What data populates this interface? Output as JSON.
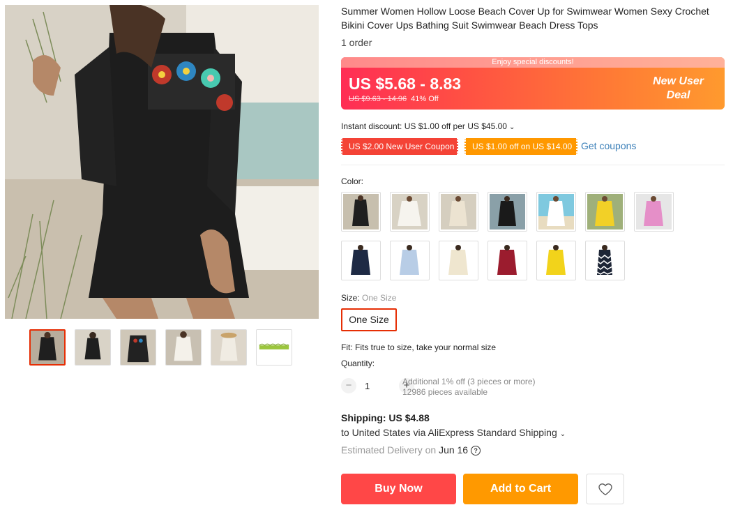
{
  "gallery": {
    "thumbnails": [
      {
        "alt": "black dress front",
        "active": true
      },
      {
        "alt": "black dress model outdoors",
        "active": false
      },
      {
        "alt": "black dress crochet detail",
        "active": false
      },
      {
        "alt": "white dress model",
        "active": false
      },
      {
        "alt": "white dress hat",
        "active": false
      },
      {
        "alt": "green crochet trim",
        "active": false
      }
    ]
  },
  "product": {
    "title": "Summer Women Hollow Loose Beach Cover Up for Swimwear Women Sexy Crochet Bikini Cover Ups Bathing Suit Swimwear Beach Dress Tops",
    "orders": "1 order"
  },
  "price": {
    "banner": "Enjoy special discounts!",
    "current": "US $5.68 - 8.83",
    "original": "US $9.63 - 14.96",
    "discount": "41% Off",
    "badge_line1": "New User",
    "badge_line2": "Deal"
  },
  "promo": {
    "instant_discount": "Instant discount: US $1.00 off per US $45.00",
    "coupon_new_user": "US $2.00 New User Coupon",
    "coupon_off": "US $1.00 off on US $14.00",
    "get_coupons": "Get coupons"
  },
  "variants": {
    "color_label": "Color:",
    "size_label": "Size: ",
    "size_selected": "One Size",
    "size_option": "One Size",
    "fit": "Fit: Fits true to size, take your normal size"
  },
  "quantity": {
    "label": "Quantity:",
    "value": "1",
    "minus": "−",
    "plus": "+",
    "note_line1": "Additional 1% off (3 pieces or more)",
    "note_line2": "12986 pieces available"
  },
  "shipping": {
    "title": "Shipping: US $4.88",
    "to": "to United States via AliExpress Standard Shipping",
    "delivery_label": "Estimated Delivery on ",
    "delivery_date": "Jun 16"
  },
  "actions": {
    "buy_now": "Buy Now",
    "add_to_cart": "Add to Cart"
  },
  "colors": {
    "accent_red": "#ff4747",
    "accent_orange": "#ff9900",
    "link_blue": "#3a7fb8"
  }
}
